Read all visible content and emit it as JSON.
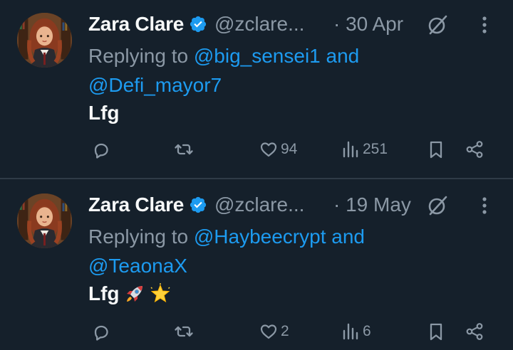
{
  "colors": {
    "background": "#15202b",
    "text_primary": "#f7f9f9",
    "text_secondary": "#8b98a5",
    "link": "#1d9bf0",
    "verified_badge": "#1d9bf0"
  },
  "tweets": [
    {
      "author_name": "Zara Clare",
      "handle": "@zclare...",
      "date": "· 30 Apr",
      "replying_prefix": "Replying to",
      "replying_handle_1": "@big_sensei1",
      "replying_and": "and",
      "replying_handle_2": "@Defi_mayor7",
      "text": "Lfg",
      "emojis": [],
      "likes": "94",
      "views": "251"
    },
    {
      "author_name": "Zara Clare",
      "handle": "@zclare...",
      "date": "· 19 May",
      "replying_prefix": "Replying to",
      "replying_handle_1": "@Haybeecrypt",
      "replying_and": "and",
      "replying_handle_2": "@TeaonaX",
      "text": "Lfg",
      "emojis": [
        "rocket-emoji",
        "glowing-star-emoji"
      ],
      "likes": "2",
      "views": "6"
    }
  ],
  "icons": {
    "verified": "verified-badge-icon",
    "edit": "edit-pencil-slash-icon",
    "more": "more-vertical-icon",
    "reply": "reply-bubble-icon",
    "retweet": "retweet-icon",
    "like": "heart-icon",
    "views": "analytics-bars-icon",
    "bookmark": "bookmark-icon",
    "share": "share-icon"
  }
}
